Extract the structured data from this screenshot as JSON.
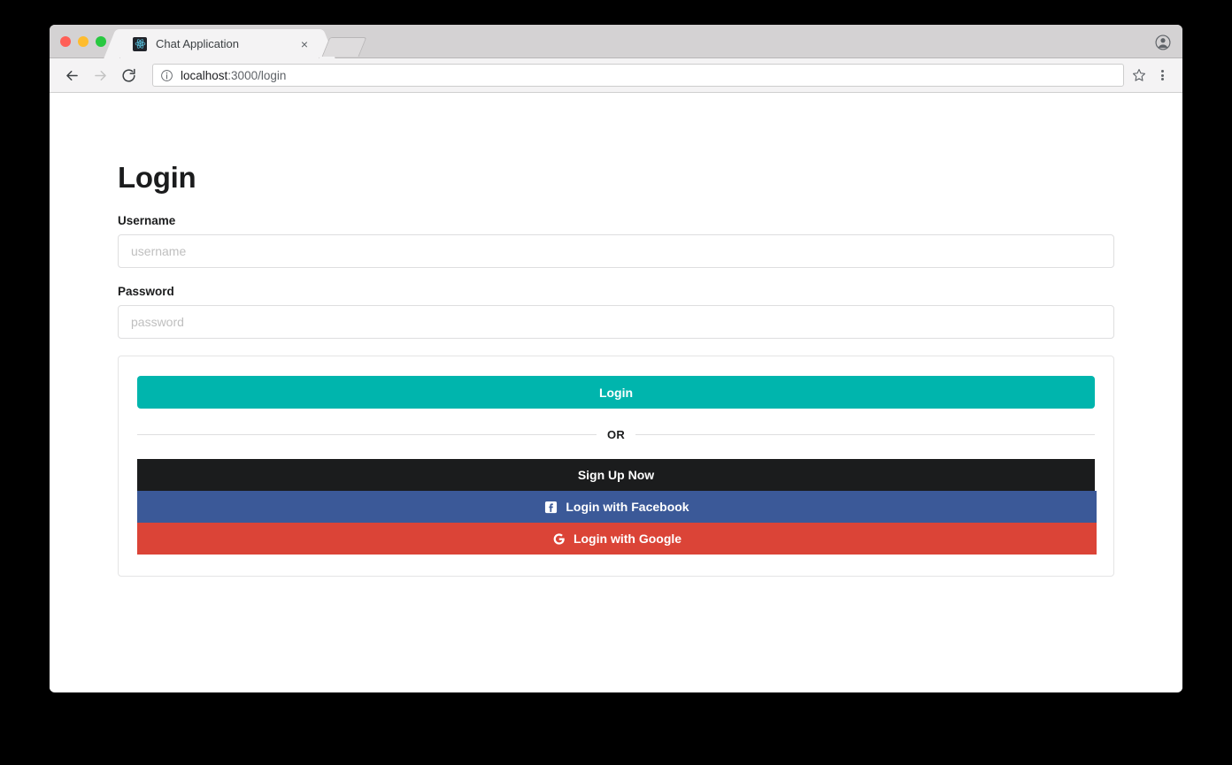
{
  "browser": {
    "tab": {
      "title": "Chat Application",
      "favicon_name": "react-logo-icon",
      "close_label": "×"
    },
    "new_tab_label": "",
    "toolbar": {
      "back_icon": "back-arrow-icon",
      "forward_icon": "forward-arrow-icon",
      "reload_icon": "reload-icon",
      "info_icon": "page-info-icon",
      "url_host": "localhost",
      "url_path": ":3000/login",
      "url_full": "localhost:3000/login",
      "star_icon": "bookmark-star-icon",
      "menu_icon": "three-dot-menu-icon"
    },
    "profile_icon": "profile-avatar-icon"
  },
  "page": {
    "title": "Login",
    "fields": [
      {
        "label": "Username",
        "placeholder": "username",
        "value": "",
        "type": "text"
      },
      {
        "label": "Password",
        "placeholder": "password",
        "value": "",
        "type": "password"
      }
    ],
    "card": {
      "login_button": "Login",
      "divider_text": "OR",
      "signup_button": "Sign Up Now",
      "facebook_button": "Login with Facebook",
      "google_button": "Login with Google",
      "facebook_icon": "facebook-f-icon",
      "google_icon": "google-g-icon"
    }
  },
  "colors": {
    "teal": "#00b5ad",
    "dark": "#1b1c1d",
    "facebook_blue": "#3b5998",
    "google_red": "#db4437",
    "border": "#dededf"
  }
}
